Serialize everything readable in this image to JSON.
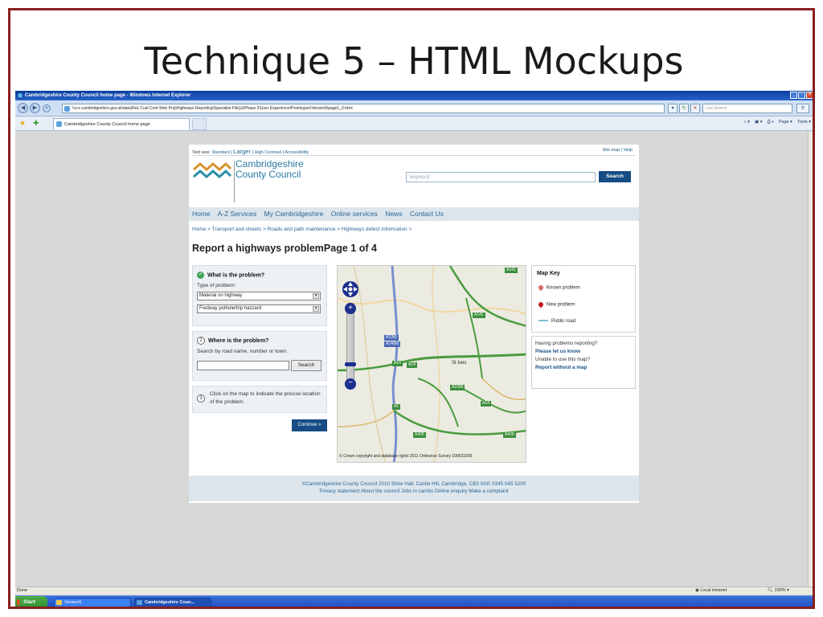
{
  "slide": {
    "title": "Technique 5 – HTML Mockups"
  },
  "browser": {
    "window_title": "Cambridgeshire County Council home page - Windows Internet Explorer",
    "address": "\\\\ccc.cambridgeshire.gov.uk\\data\\Res Cust Cont Web Proj\\Highways Reporting\\Specialist File(s)\\Phase 2\\User Experience\\Prototypes\\Version5\\page1_0.html",
    "live_search_placeholder": "Live Search",
    "tab_label": "Cambridgeshire County Council home page",
    "command_bar": [
      "Page ▾",
      "Tools ▾"
    ],
    "status_left": "Done",
    "status_zone": "Local intranet",
    "status_zoom": "100%"
  },
  "site": {
    "util": {
      "prefix": "Text size:",
      "standard": "Standard",
      "larger": "Larger",
      "high_contrast": "High Contrast",
      "accessibility": "Accessibility",
      "sep": "|",
      "site_map": "Site map",
      "help": "Help"
    },
    "logo": {
      "line1": "Cambridgeshire",
      "line2": "County Council"
    },
    "search": {
      "placeholder": "keyword",
      "button": "Search"
    },
    "nav": [
      "Home",
      "A-Z Services",
      "My Cambridgeshire",
      "Online services",
      "News",
      "Contact Us"
    ],
    "breadcrumb": "Home > Transport and streets > Roads and path maintenance > Highways defect information >",
    "heading": "Report a highways problemPage 1 of 4",
    "panel1": {
      "title": "What is the problem?",
      "type_label": "Type of problem:",
      "select1": "Material on highway",
      "select2": "Footway pothole/trip hazzard"
    },
    "panel2": {
      "number": "2",
      "title": "Where is the problem?",
      "label": "Search by road name, number or town:",
      "input_value": "",
      "button": "Search"
    },
    "panel3": {
      "number": "3",
      "text": "Click on the map to indicate the precise location of the problem."
    },
    "continue_button": "Continue »",
    "map": {
      "town": "St Ives",
      "road_tags": [
        "A141",
        "A141",
        "A1(M)",
        "A14(M)",
        "A14",
        "A14",
        "A1096",
        "A14",
        "A1",
        "A428",
        "A428"
      ],
      "copyright": "© Crown copyright and database rights 2011 Ordnance Survey 100023205"
    },
    "map_key": {
      "title": "Map Key",
      "known": "Known problem",
      "new": "New problem",
      "road": "Public road"
    },
    "reporting": {
      "q1": "Having problems reporting?",
      "l1": "Please let us know",
      "q2": "Unable to use this map?",
      "l2": "Report without a map"
    },
    "footer": {
      "line1": "©Cambridgeshire County Council 2010  Shire Hall, Castle Hill, Cambridge, CB3 0AP, 0345 045 5200",
      "links": [
        "Privacy statement",
        "About the council",
        "Jobs in cambs",
        "Online enquiry",
        "Make a complaint"
      ]
    }
  },
  "taskbar": {
    "start": "Start",
    "items": [
      "Version5",
      "Cambridgeshire Coun..."
    ]
  },
  "colors": {
    "frame": "#8a1e1e",
    "brand_blue": "#174c84",
    "nav_bg": "#dde6ec",
    "link": "#2a6496",
    "road_green": "#3d8e3d"
  }
}
